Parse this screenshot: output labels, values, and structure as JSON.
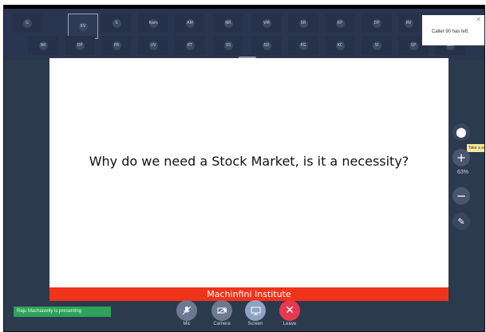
{
  "strip": {
    "row1": [
      "G",
      "KV",
      "S",
      "Ram",
      "AM",
      "NR",
      "VM",
      "SR",
      "KP",
      "DP",
      "RV"
    ],
    "row2": [
      "NK",
      "DP",
      "PR",
      "UV",
      "KT",
      "SS",
      "SD",
      "PG",
      "KC",
      "SI",
      "SP",
      "SM"
    ],
    "selected_index": 1
  },
  "caller_notice": {
    "text": "Caller 90 has left."
  },
  "slide": {
    "title": "Why do we need a Stock Market, is it a necessity?",
    "footer": "Machinfini Institute"
  },
  "right_tools": {
    "tooltip": "Take a sn",
    "zoom_percent": "63%"
  },
  "presenting_status": "Raju Machiavelly is presenting",
  "controls": [
    {
      "label": "Mic",
      "icon": "mic-off-icon",
      "color": "#6d7892"
    },
    {
      "label": "Camera",
      "icon": "camera-off-icon",
      "color": "#6d7892"
    },
    {
      "label": "Screen",
      "icon": "screen-share-icon",
      "color": "#8fa3c4"
    },
    {
      "label": "Leave",
      "icon": "close-icon",
      "color": "#e8384f"
    }
  ]
}
